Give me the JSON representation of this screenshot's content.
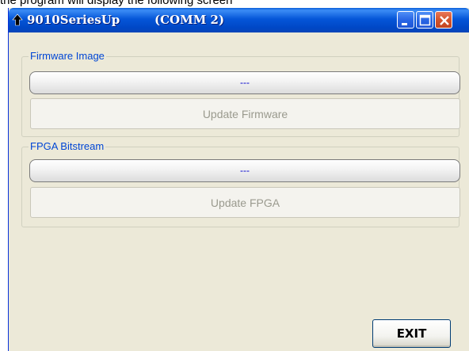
{
  "background_text": "the program will display the following screen",
  "window": {
    "title": "9010SeriesUp",
    "comm": "(COMM 2)",
    "title_bar_color": "#0556d8",
    "controls": [
      "minimize-icon",
      "maximize-icon",
      "close-icon"
    ]
  },
  "firmware_group": {
    "label": "Firmware Image",
    "progress_text": "---",
    "button_label": "Update Firmware",
    "button_enabled": false
  },
  "fpga_group": {
    "label": "FPGA Bitstream",
    "progress_text": "---",
    "button_label": "Update FPGA",
    "button_enabled": false
  },
  "exit_button": {
    "label": "EXIT"
  }
}
